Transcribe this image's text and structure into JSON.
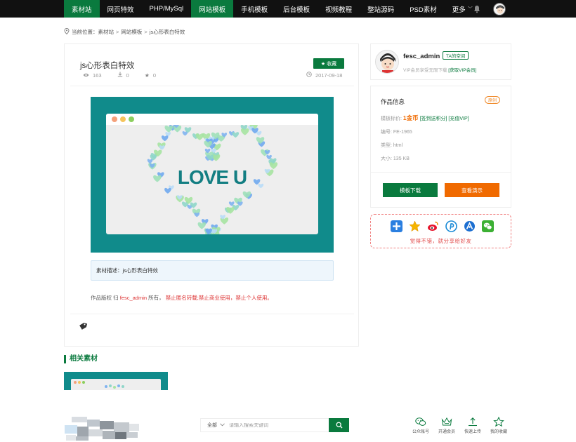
{
  "nav": {
    "items": [
      {
        "label": "素材站",
        "active": true
      },
      {
        "label": "网页特效",
        "active": false
      },
      {
        "label": "PHP/MySql",
        "active": false
      },
      {
        "label": "网站模板",
        "active": true
      },
      {
        "label": "手机模板",
        "active": false
      },
      {
        "label": "后台模板",
        "active": false
      },
      {
        "label": "视频教程",
        "active": false
      },
      {
        "label": "整站源码",
        "active": false
      },
      {
        "label": "PSD素材",
        "active": false
      },
      {
        "label": "更多",
        "active": false
      }
    ],
    "more_caret": "﹀"
  },
  "breadcrumb": {
    "prefix": "当前位置：",
    "items": [
      "素材站",
      "网站模板",
      "js心形表白特效"
    ],
    "separator": ">"
  },
  "article": {
    "title": "js心形表白特效",
    "favorite_label": "收藏",
    "views": "163",
    "downloads": "0",
    "stars": "0",
    "date": "2017-09-18",
    "preview_text": "LOVE U",
    "description_label": "素材描述：",
    "description": "js心形表白特效",
    "copyright_prefix": "作品版权 归",
    "copyright_owner": "fesc_admin",
    "copyright_mid": "所有，",
    "copyright_warning": "禁止匿名转载;禁止商业使用，禁止个人使用。"
  },
  "related": {
    "title": "相关素材"
  },
  "author": {
    "name": "fesc_admin",
    "space_label": "TA的空间",
    "vip_text": "VIP会员享受无限下载",
    "vip_link": "[获取VIP会员]"
  },
  "info": {
    "title": "作品信息",
    "badge": "原创",
    "price_label": "模板标价:",
    "price_value": "1金币",
    "price_links": "[签到送积分] [充值VIP]",
    "id_label": "编号:",
    "id_value": "FE-1965",
    "type_label": "类型:",
    "type_value": "html",
    "size_label": "大小:",
    "size_value": "135 KB",
    "download_label": "模板下载",
    "demo_label": "查看演示"
  },
  "share": {
    "text": "觉得不错，就分享给好友"
  },
  "bottom": {
    "search_scope": "全部",
    "search_placeholder": "请输入搜索关键词",
    "quick": [
      {
        "label": "公众账号",
        "icon": "wechat-outline-icon"
      },
      {
        "label": "开通会员",
        "icon": "crown-icon"
      },
      {
        "label": "快速上传",
        "icon": "upload-icon"
      },
      {
        "label": "我的收藏",
        "icon": "star-outline-icon"
      }
    ]
  },
  "colors": {
    "brand_green": "#0a7a3e",
    "orange": "#f06a00",
    "preview_teal": "#108b8b",
    "nav_bg": "#111111"
  }
}
